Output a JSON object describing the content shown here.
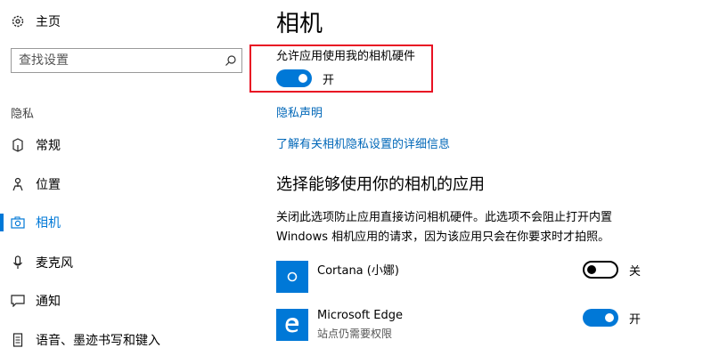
{
  "sidebar": {
    "home_label": "主页",
    "search_placeholder": "查找设置",
    "group_label": "隐私",
    "items": [
      {
        "label": "常规"
      },
      {
        "label": "位置"
      },
      {
        "label": "相机",
        "active": true
      },
      {
        "label": "麦克风"
      },
      {
        "label": "通知"
      },
      {
        "label": "语音、墨迹书写和键入"
      }
    ]
  },
  "main": {
    "title": "相机",
    "allow_label": "允许应用使用我的相机硬件",
    "allow_state": "开",
    "privacy_link": "隐私声明",
    "learn_more_link": "了解有关相机隐私设置的详细信息",
    "section_title": "选择能够使用你的相机的应用",
    "description_line1": "关闭此选项防止应用直接访问相机硬件。此选项不会阻止打开内置",
    "description_line2": "Windows 相机应用的请求，因为该应用只会在你要求时才拍照。",
    "apps": [
      {
        "name": "Cortana (小娜)",
        "subtitle": "",
        "state": "关",
        "on": false
      },
      {
        "name": "Microsoft Edge",
        "subtitle": "站点仍需要权限",
        "state": "开",
        "on": true
      }
    ]
  },
  "colors": {
    "accent": "#0078d7",
    "highlight_border": "#e81123",
    "link": "#0067b8"
  },
  "icons": [
    "gear-icon",
    "search-icon",
    "general-icon",
    "location-icon",
    "camera-icon",
    "microphone-icon",
    "notification-icon",
    "speech-inking-icon",
    "cortana-icon",
    "edge-icon"
  ]
}
